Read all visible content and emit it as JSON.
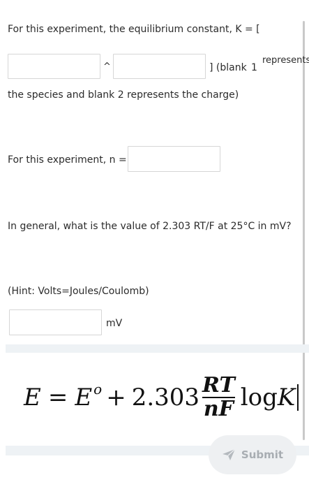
{
  "question": {
    "k_prompt": "For this experiment, the equilibrium constant, K = [",
    "caret": "^",
    "bracket_close": "] (blank",
    "blank_number": "1",
    "represents": "represents",
    "k_prompt_cont": "the species and blank 2 represents the charge)",
    "blank1_value": "",
    "blank2_value": "",
    "n_prompt": "For this experiment, n =",
    "n_value": "",
    "rtf_prompt": "In general, what is the value of 2.303 RT/F at 25°C in mV?",
    "hint": "(Hint: Volts=Joules/Coulomb)",
    "mv_value": "",
    "mv_unit": "mV"
  },
  "formula": {
    "E": "E",
    "eq": "=",
    "E0": "E",
    "E0_sup": "o",
    "plus": "+",
    "coeff": "2.303",
    "numerator": "RT",
    "denominator": "nF",
    "log": "log",
    "K": "K"
  },
  "submit": {
    "label": "Submit",
    "icon": "send-icon",
    "color": "#a8adb2"
  },
  "colors": {
    "text": "#2b2b2b",
    "band": "#eef2f5",
    "button_bg": "#eef0f2",
    "border": "#d6d6d6"
  }
}
